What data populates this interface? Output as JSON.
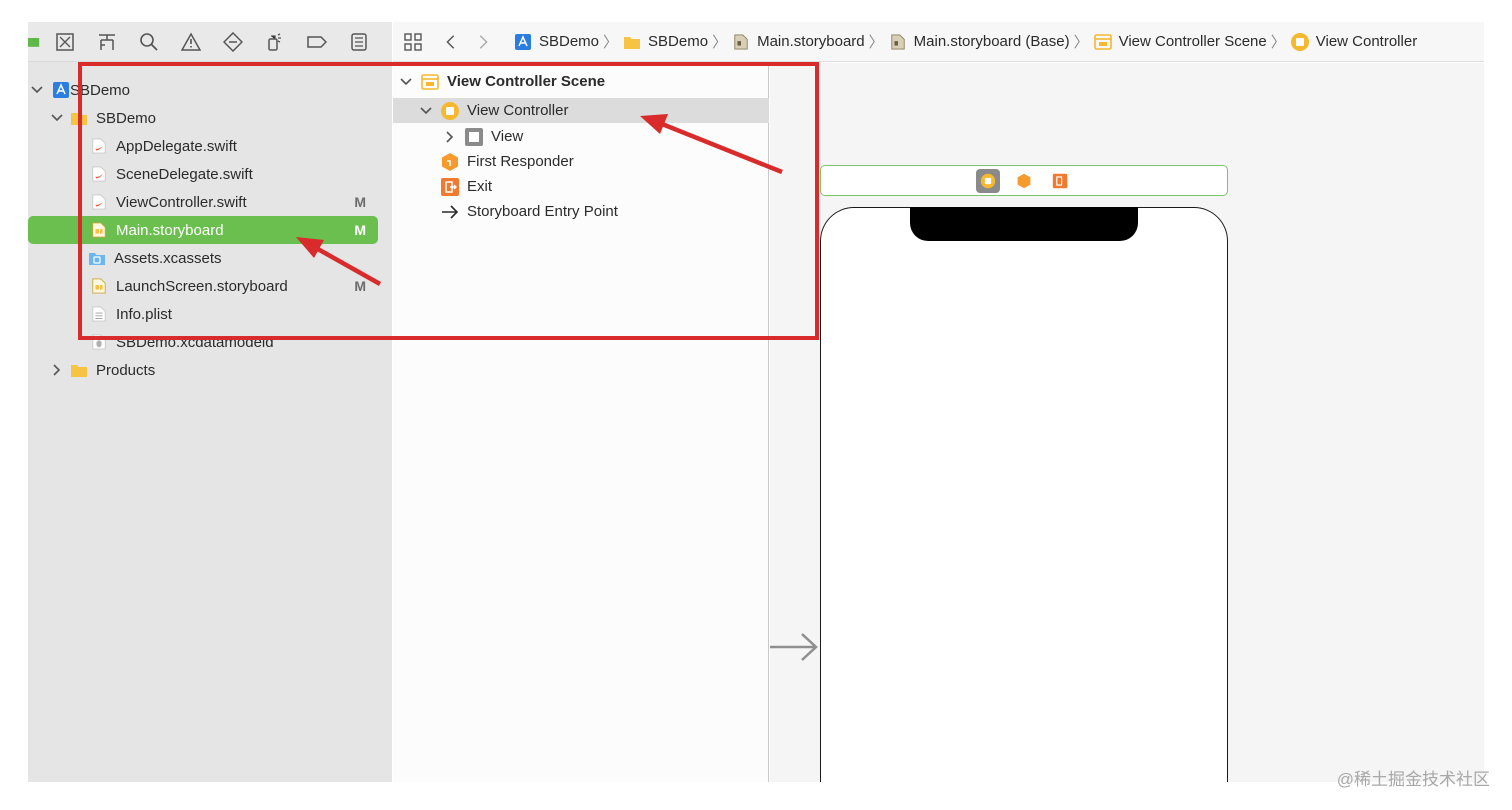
{
  "jumpbar": {
    "crumbs": [
      {
        "label": "SBDemo",
        "icon": "project-icon"
      },
      {
        "label": "SBDemo",
        "icon": "folder-icon"
      },
      {
        "label": "Main.storyboard",
        "icon": "storyboard-file-icon"
      },
      {
        "label": "Main.storyboard (Base)",
        "icon": "storyboard-file-icon"
      },
      {
        "label": "View Controller Scene",
        "icon": "scene-icon"
      },
      {
        "label": "View Controller",
        "icon": "view-controller-icon"
      }
    ]
  },
  "navigator": {
    "items": [
      {
        "label": "SBDemo",
        "badge": ""
      },
      {
        "label": "SBDemo",
        "badge": ""
      },
      {
        "label": "AppDelegate.swift",
        "badge": ""
      },
      {
        "label": "SceneDelegate.swift",
        "badge": ""
      },
      {
        "label": "ViewController.swift",
        "badge": "M"
      },
      {
        "label": "Main.storyboard",
        "badge": "M"
      },
      {
        "label": "Assets.xcassets",
        "badge": ""
      },
      {
        "label": "LaunchScreen.storyboard",
        "badge": "M"
      },
      {
        "label": "Info.plist",
        "badge": ""
      },
      {
        "label": "SBDemo.xcdatamodeld",
        "badge": ""
      },
      {
        "label": "Products",
        "badge": ""
      }
    ]
  },
  "outline": {
    "items": [
      {
        "label": "View Controller Scene"
      },
      {
        "label": "View Controller"
      },
      {
        "label": "View"
      },
      {
        "label": "First Responder"
      },
      {
        "label": "Exit"
      },
      {
        "label": "Storyboard Entry Point"
      }
    ]
  },
  "colors": {
    "selection": "#6bbf4e",
    "annotation": "#d92b2b",
    "scene_dock_border": "#7ac46b",
    "swift": "#f05138",
    "storyboard": "#f5c242"
  },
  "watermark": "@稀土掘金技术社区"
}
